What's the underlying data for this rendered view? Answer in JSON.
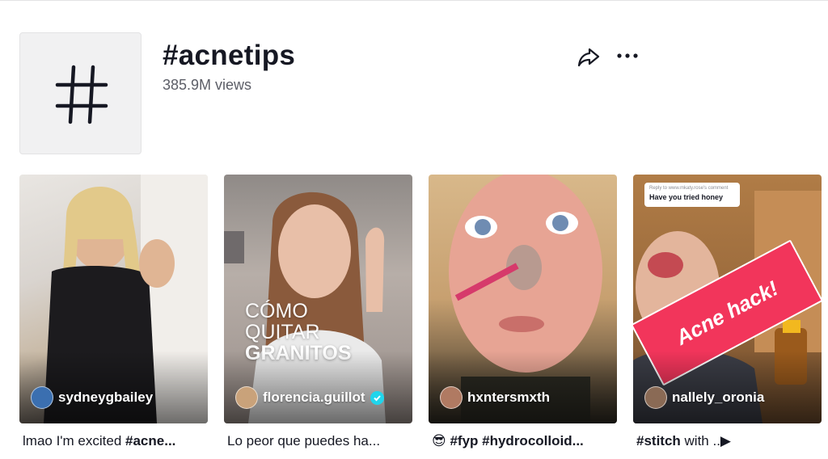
{
  "hashtag": {
    "title": "#acnetips",
    "views": "385.9M views"
  },
  "actions": {
    "share_icon": "share-arrow-icon",
    "more_icon": "more-dots-icon"
  },
  "videos": [
    {
      "author": "sydneygbailey",
      "caption_text": "lmao I'm excited ",
      "caption_tag": "#acne...",
      "verified": false,
      "avatar_color": "#3b6fb0"
    },
    {
      "author": "florencia.guillot",
      "caption_text": "Lo peor que puedes ha...",
      "verified": true,
      "overlay_line1": "CÓMO",
      "overlay_line2": "QUITAR",
      "overlay_line3": "GRANITOS",
      "avatar_color": "#c9a27a"
    },
    {
      "author": "hxntersmxth",
      "caption_emoji": "😎",
      "caption_text": " #fyp #hydrocolloid...",
      "verified": false,
      "avatar_color": "#b07a62"
    },
    {
      "author": "nallely_oronia",
      "caption_tag": "#stitch",
      "caption_text": " with ..",
      "caption_play": "▶",
      "verified": false,
      "banner_text": "Acne hack!",
      "reply_small": "Reply to www.mkaty.rose's comment",
      "reply_main": "Have you tried honey",
      "avatar_color": "#8a6a55"
    }
  ],
  "colors": {
    "accent_verified": "#20d5ec",
    "banner": "#f2355b",
    "text_primary": "#161823",
    "text_secondary": "#5c5e67"
  }
}
